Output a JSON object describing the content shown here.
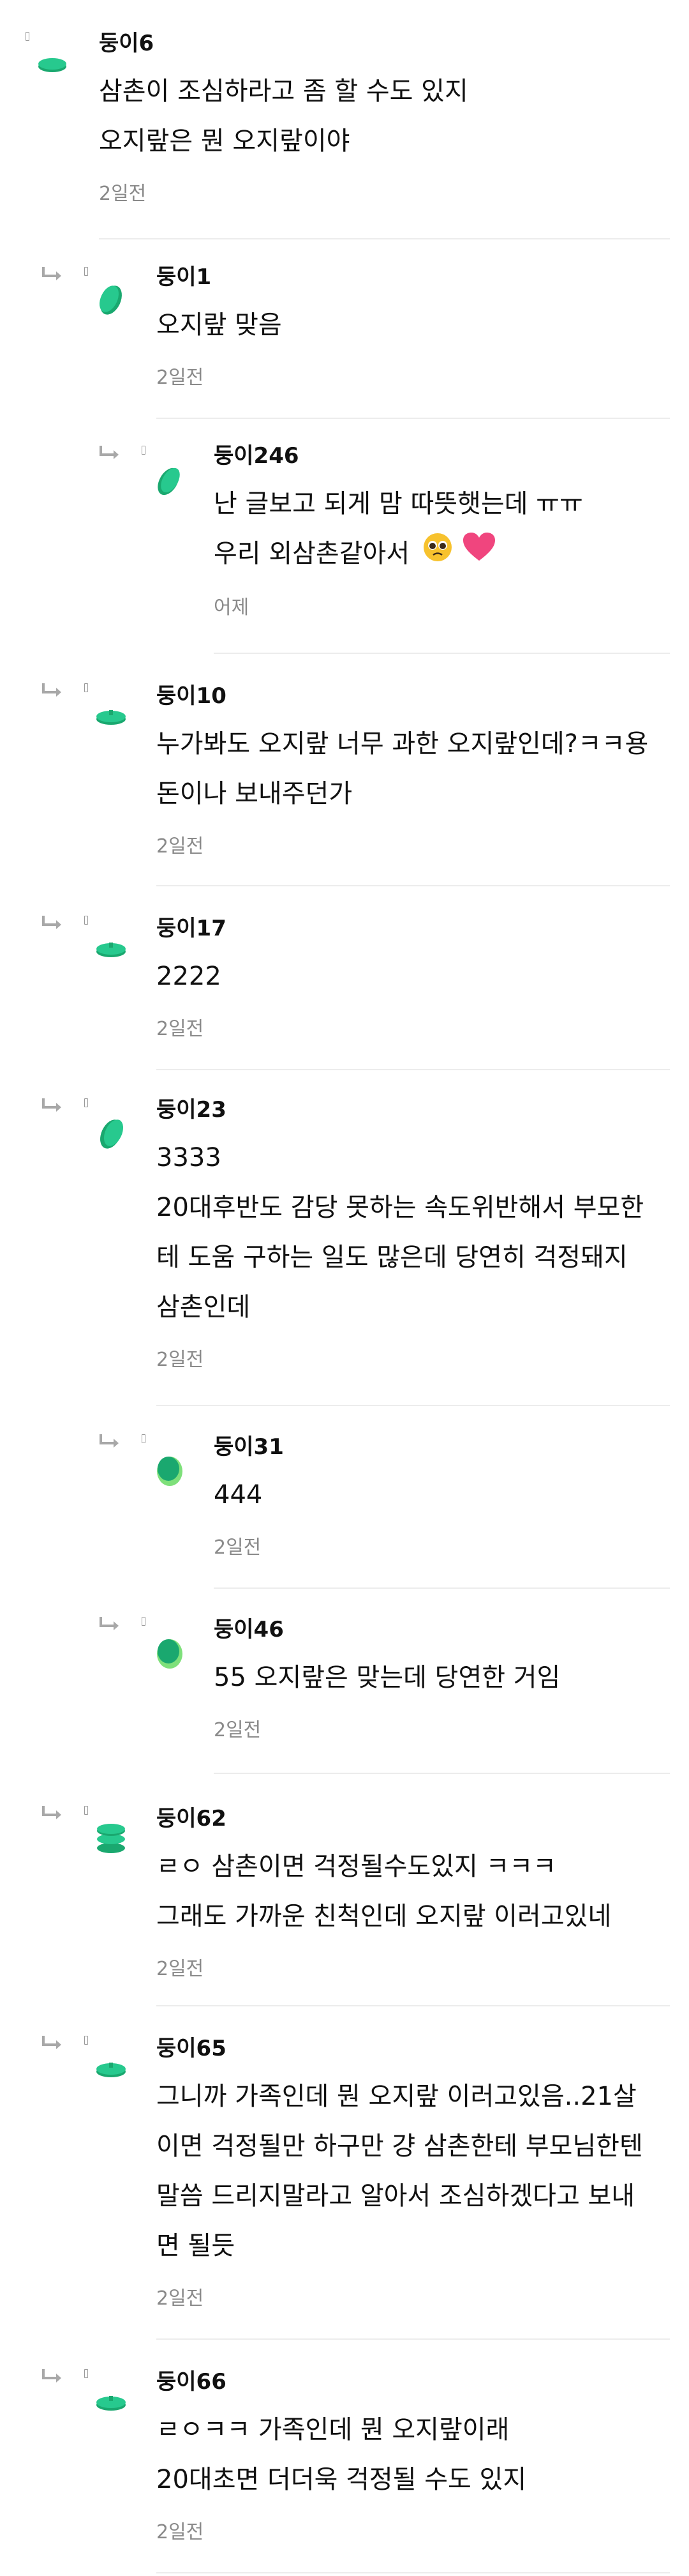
{
  "comments": [
    {
      "nick": "둥이6",
      "lines": [
        "삼촌이 조심하라고 좀 할 수도 있지",
        "오지랖은 뭔 오지랖이야"
      ],
      "time": "2일전"
    },
    {
      "nick": "둥이1",
      "lines": [
        "오지랖 맞음"
      ],
      "time": "2일전"
    },
    {
      "nick": "둥이246",
      "lines": [
        "난 글보고 되게 맘 따뜻햇는데 ㅠㅠ",
        "우리 외삼촌같아서"
      ],
      "time": "어제"
    },
    {
      "nick": "둥이10",
      "lines": [
        "누가봐도 오지랖 너무 과한 오지랖인데?ㅋㅋ용",
        "돈이나 보내주던가"
      ],
      "time": "2일전"
    },
    {
      "nick": "둥이17",
      "lines": [
        "2222"
      ],
      "time": "2일전"
    },
    {
      "nick": "둥이23",
      "lines": [
        "3333",
        "20대후반도 감당 못하는 속도위반해서 부모한",
        "테 도움 구하는 일도 많은데 당연히 걱정돼지",
        "삼촌인데"
      ],
      "time": "2일전"
    },
    {
      "nick": "둥이31",
      "lines": [
        "444"
      ],
      "time": "2일전"
    },
    {
      "nick": "둥이46",
      "lines": [
        "55 오지랖은 맞는데 당연한 거임"
      ],
      "time": "2일전"
    },
    {
      "nick": "둥이62",
      "lines": [
        "ㄹㅇ 삼촌이면 걱정될수도있지 ㅋㅋㅋ",
        "그래도 가까운 친척인데 오지랖 이러고있네"
      ],
      "time": "2일전"
    },
    {
      "nick": "둥이65",
      "lines": [
        "그니까 가족인데 뭔 오지랖 이러고있음..21살",
        "이면 걱정될만 하구만 걍 삼촌한테 부모님한텐",
        "말씀 드리지말라고 알아서 조심하겠다고 보내",
        "면 될듯"
      ],
      "time": "2일전"
    },
    {
      "nick": "둥이66",
      "lines": [
        "ㄹㅇㅋㅋ 가족인데 뭔 오지랖이래",
        "20대초면 더더욱 걱정될 수도 있지"
      ],
      "time": "2일전"
    }
  ],
  "colors": {
    "accent": "#27c98e",
    "accent_dark": "#1aa86f",
    "accent_light": "#7ee07a",
    "divider": "#ececec",
    "meta": "#8a8a8a"
  },
  "icons": {
    "reply": "reply-arrow-icon",
    "avatar": "bean-avatar-icon",
    "emoji": [
      "pleading-face-emoji",
      "pink-heart-emoji"
    ]
  }
}
